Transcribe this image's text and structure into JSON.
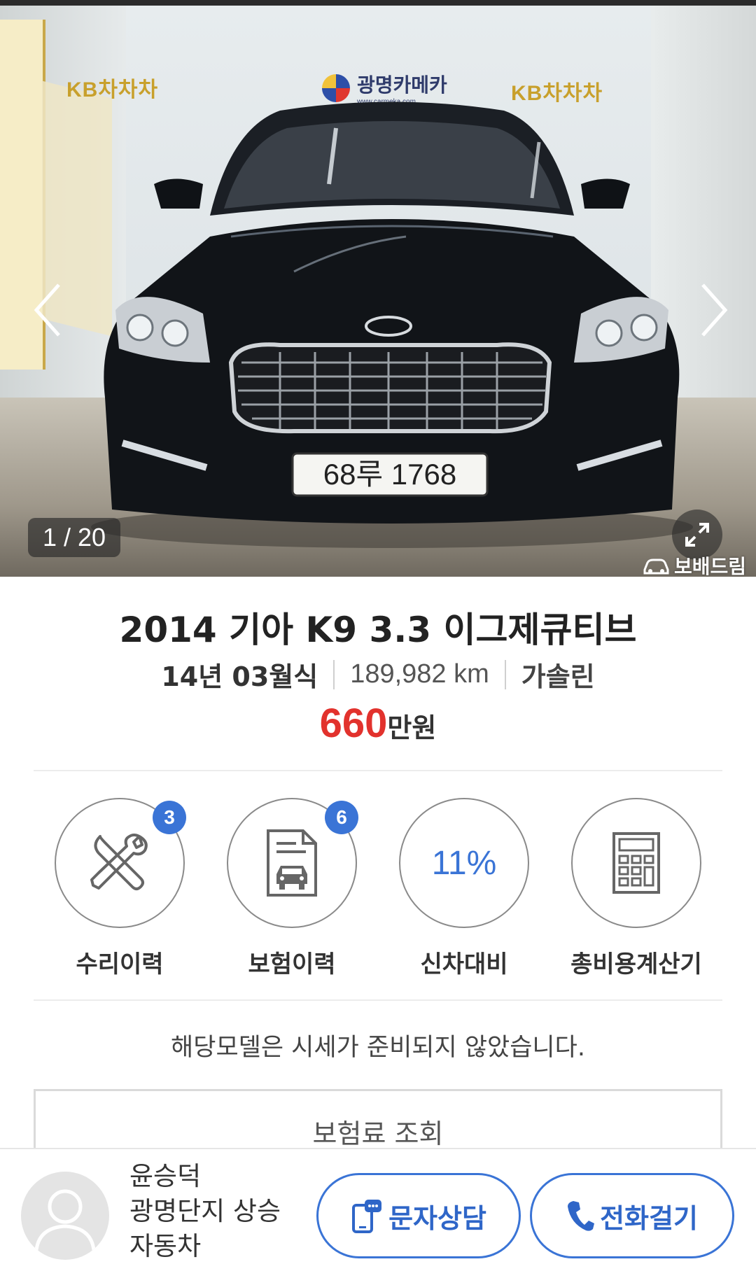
{
  "gallery": {
    "counter": "1 / 20",
    "plate": "68루 1768",
    "wall_logos": {
      "kb_left": "KB차차차",
      "center": "광명카메카",
      "center_url": "www.carmeka.com",
      "kb_right": "KB차차차"
    },
    "watermark": "보배드림"
  },
  "car": {
    "title": "2014 기아 K9 3.3 이그제큐티브",
    "year": "14년 03월식",
    "mileage": "189,982 km",
    "fuel": "가솔린",
    "price_value": "660",
    "price_unit": "만원"
  },
  "features": [
    {
      "label": "수리이력",
      "badge": "3",
      "icon": "tools-icon"
    },
    {
      "label": "보험이력",
      "badge": "6",
      "icon": "insurance-document-icon"
    },
    {
      "label": "신차대비",
      "value": "11%"
    },
    {
      "label": "총비용계산기",
      "icon": "calculator-icon"
    }
  ],
  "notice": "해당모델은 시세가 준비되지 않았습니다.",
  "insurance_button": "보험료 조회",
  "dealer": {
    "line1": "윤승덕",
    "line2": "광명단지 상승",
    "line3": "자동차"
  },
  "actions": {
    "sms": "문자상담",
    "call": "전화걸기"
  },
  "colors": {
    "accent_blue": "#3a74d6",
    "price_red": "#e2322d"
  }
}
